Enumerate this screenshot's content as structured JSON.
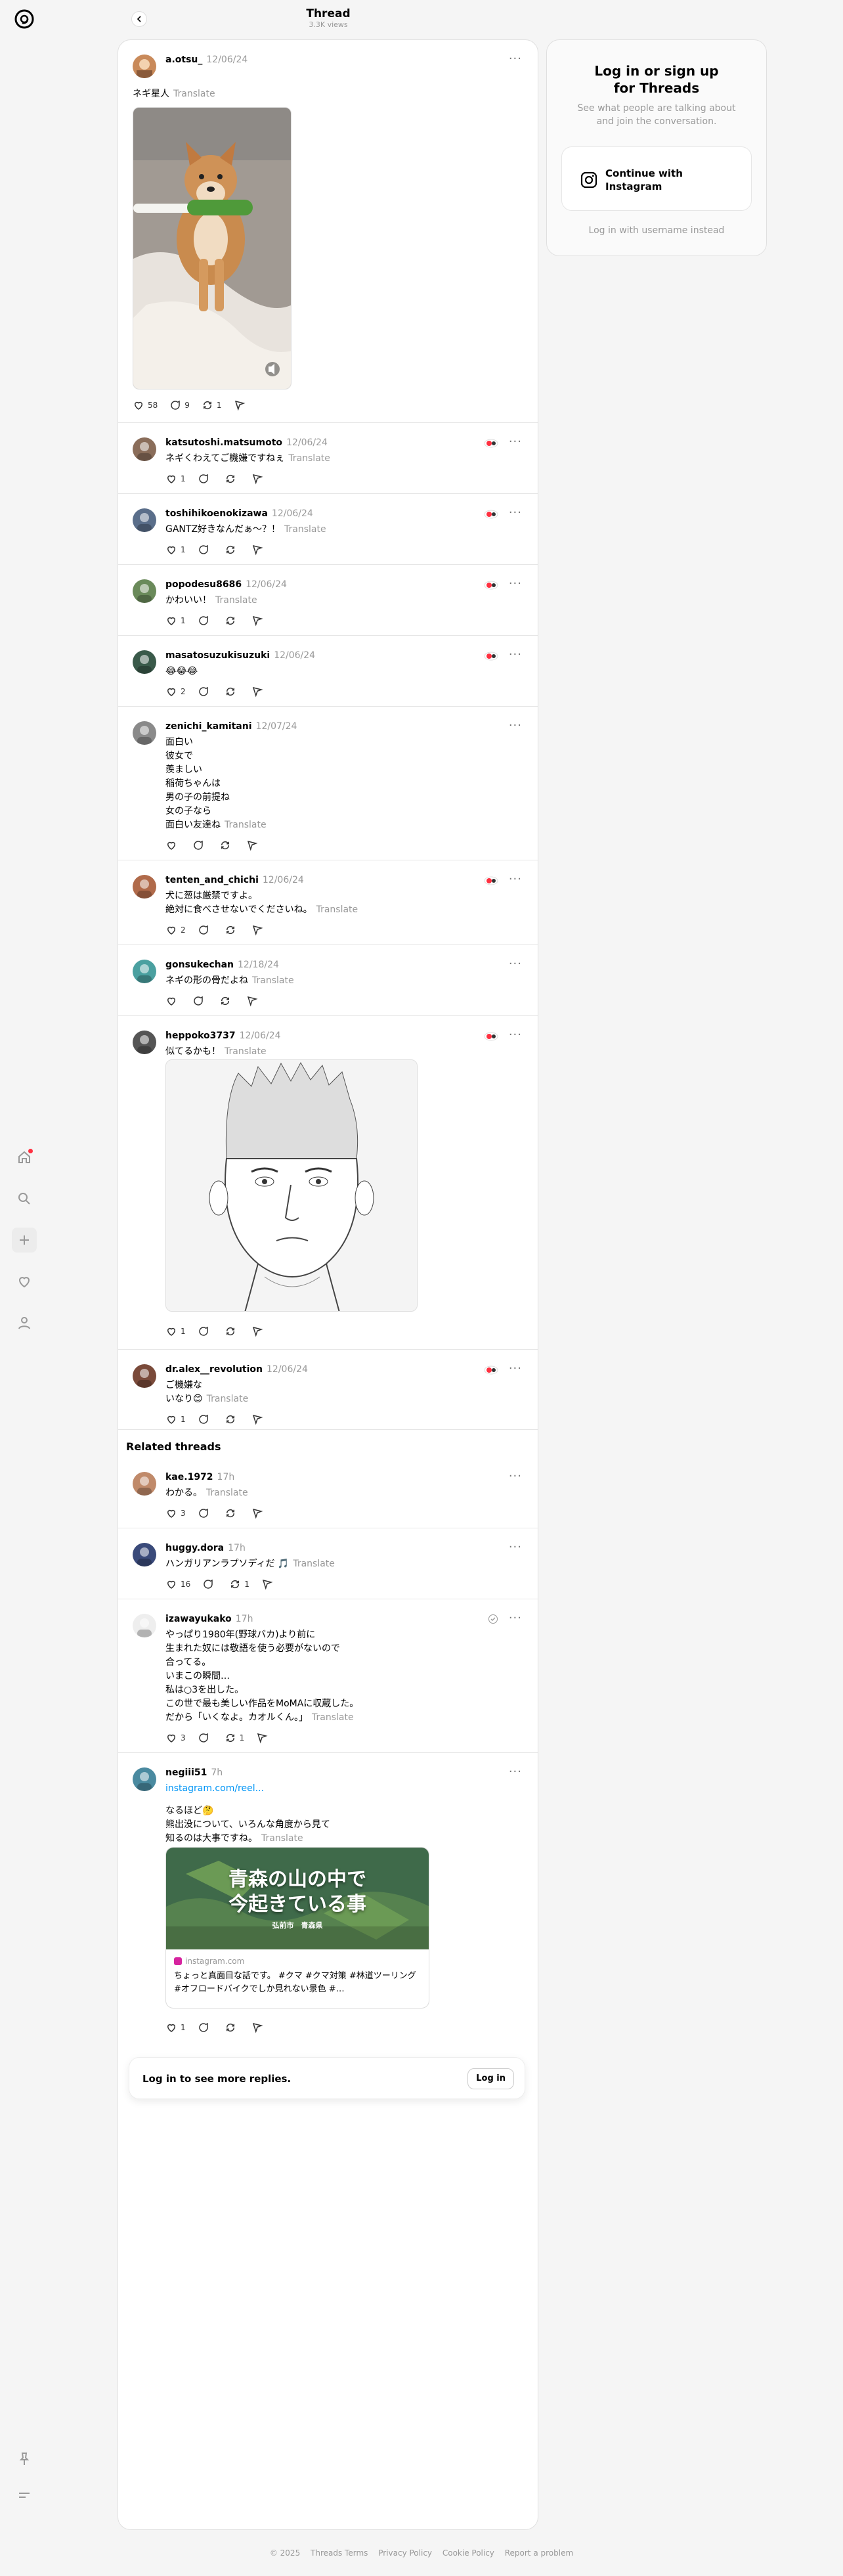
{
  "header": {
    "title": "Thread",
    "views": "3.3K views"
  },
  "main_post": {
    "user": "a.otsu_",
    "date": "12/06/24",
    "text": "ネギ星人",
    "translate": "Translate",
    "likes": "58",
    "replies": "9",
    "reposts": "1"
  },
  "replies": [
    {
      "user": "katsutoshi.matsumoto",
      "date": "12/06/24",
      "text": "ネギくわえてご機嫌ですねぇ",
      "translate": "Translate",
      "likes": "1",
      "replies": "",
      "reposts": ""
    },
    {
      "user": "toshihikoenokizawa",
      "date": "12/06/24",
      "text": "GANTZ好きなんだぁ〜？！",
      "translate": "Translate",
      "likes": "1",
      "replies": "",
      "reposts": ""
    },
    {
      "user": "popodesu8686",
      "date": "12/06/24",
      "text": "かわいい！",
      "translate": "Translate",
      "likes": "1",
      "replies": "",
      "reposts": ""
    },
    {
      "user": "masatosuzukisuzuki",
      "date": "12/06/24",
      "text": "😂😂😂",
      "translate": "",
      "likes": "2",
      "replies": "",
      "reposts": ""
    },
    {
      "user": "zenichi_kamitani",
      "date": "12/07/24",
      "text": "面白い\n彼女で\n羨ましい\n稲荷ちゃんは\n男の子の前提ね\n女の子なら\n面白い友達ね",
      "translate": "Translate",
      "likes": "",
      "replies": "",
      "reposts": ""
    },
    {
      "user": "tenten_and_chichi",
      "date": "12/06/24",
      "text": "犬に葱は厳禁ですよ。\n絶対に食べさせないでくださいね。",
      "translate": "Translate",
      "likes": "2",
      "replies": "",
      "reposts": ""
    },
    {
      "user": "gonsukechan",
      "date": "12/18/24",
      "text": "ネギの形の骨だよね",
      "translate": "Translate",
      "likes": "",
      "replies": "",
      "reposts": ""
    },
    {
      "user": "heppoko3737",
      "date": "12/06/24",
      "text": "似てるかも！",
      "translate": "Translate",
      "likes": "1",
      "replies": "",
      "reposts": ""
    },
    {
      "user": "dr.alex__revolution",
      "date": "12/06/24",
      "text": "ご機嫌な\nいなり😊",
      "translate": "Translate",
      "likes": "1",
      "replies": "",
      "reposts": ""
    }
  ],
  "related_title": "Related threads",
  "related": [
    {
      "user": "kae.1972",
      "date": "17h",
      "text": "わかる。",
      "translate": "Translate",
      "likes": "3",
      "replies": "",
      "reposts": ""
    },
    {
      "user": "huggy.dora",
      "date": "17h",
      "text": "ハンガリアンラプソディだ 🎵",
      "translate": "Translate",
      "likes": "16",
      "replies": "",
      "reposts": "1"
    },
    {
      "user": "izawayukako",
      "date": "17h",
      "text": "やっぱり1980年(野球バカ)より前に\n生まれた奴には敬語を使う必要がないので\n合ってる。\nいまこの瞬間…\n私は○3を出した。\nこの世で最も美しい作品をMoMAに収蔵した。\nだから「いくなよ。カオルくん。」",
      "translate": "Translate",
      "likes": "3",
      "replies": "",
      "reposts": "1"
    },
    {
      "user": "negiii51",
      "date": "7h",
      "link": "instagram.com/reel...",
      "text": "なるほど🤔\n熊出没について、いろんな角度から見て\n知るのは大事ですね。",
      "translate": "Translate",
      "likes": "1",
      "replies": "",
      "reposts": ""
    }
  ],
  "link_card": {
    "overlay_line1": "青森の山の中で",
    "overlay_line2": "今起きている事",
    "overlay_small": "弘前市　青森県",
    "domain": "instagram.com",
    "desc": "ちょっと真面目な話です。 #クマ #クマ対策 #林道ツーリング #オフロードバイクでしか見れない景色 #…"
  },
  "login_bar": {
    "text": "Log in to see more replies.",
    "button": "Log in"
  },
  "sidebar": {
    "title": "Log in or sign up\nfor Threads",
    "subtitle": "See what people are talking about\nand join the conversation.",
    "instagram_button": "Continue with\nInstagram",
    "username_link": "Log in with username instead"
  },
  "footer": {
    "copyright": "© 2025",
    "links": [
      "Threads Terms",
      "Privacy Policy",
      "Cookie Policy",
      "Report a problem"
    ]
  },
  "colors": {
    "accent_red": "#ff3040",
    "link_blue": "#0095f6"
  }
}
